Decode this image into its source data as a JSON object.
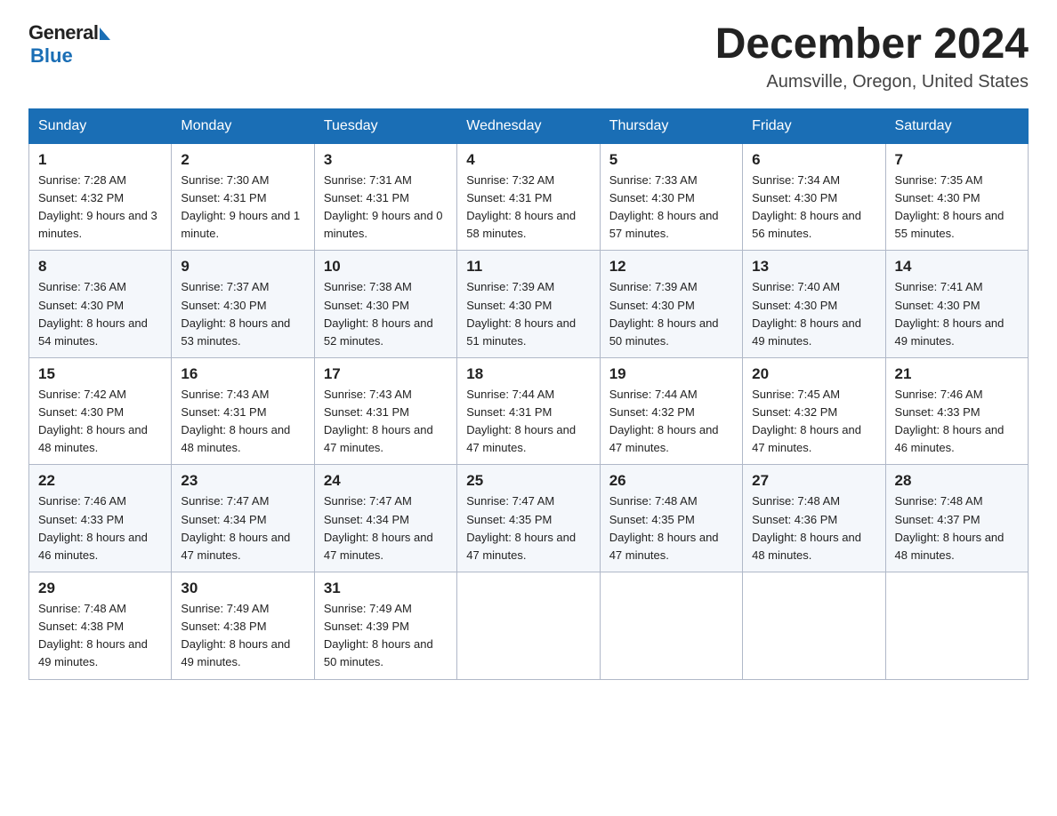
{
  "logo": {
    "general": "General",
    "blue": "Blue"
  },
  "title": "December 2024",
  "location": "Aumsville, Oregon, United States",
  "days_of_week": [
    "Sunday",
    "Monday",
    "Tuesday",
    "Wednesday",
    "Thursday",
    "Friday",
    "Saturday"
  ],
  "weeks": [
    [
      {
        "day": "1",
        "sunrise": "7:28 AM",
        "sunset": "4:32 PM",
        "daylight": "9 hours and 3 minutes."
      },
      {
        "day": "2",
        "sunrise": "7:30 AM",
        "sunset": "4:31 PM",
        "daylight": "9 hours and 1 minute."
      },
      {
        "day": "3",
        "sunrise": "7:31 AM",
        "sunset": "4:31 PM",
        "daylight": "9 hours and 0 minutes."
      },
      {
        "day": "4",
        "sunrise": "7:32 AM",
        "sunset": "4:31 PM",
        "daylight": "8 hours and 58 minutes."
      },
      {
        "day": "5",
        "sunrise": "7:33 AM",
        "sunset": "4:30 PM",
        "daylight": "8 hours and 57 minutes."
      },
      {
        "day": "6",
        "sunrise": "7:34 AM",
        "sunset": "4:30 PM",
        "daylight": "8 hours and 56 minutes."
      },
      {
        "day": "7",
        "sunrise": "7:35 AM",
        "sunset": "4:30 PM",
        "daylight": "8 hours and 55 minutes."
      }
    ],
    [
      {
        "day": "8",
        "sunrise": "7:36 AM",
        "sunset": "4:30 PM",
        "daylight": "8 hours and 54 minutes."
      },
      {
        "day": "9",
        "sunrise": "7:37 AM",
        "sunset": "4:30 PM",
        "daylight": "8 hours and 53 minutes."
      },
      {
        "day": "10",
        "sunrise": "7:38 AM",
        "sunset": "4:30 PM",
        "daylight": "8 hours and 52 minutes."
      },
      {
        "day": "11",
        "sunrise": "7:39 AM",
        "sunset": "4:30 PM",
        "daylight": "8 hours and 51 minutes."
      },
      {
        "day": "12",
        "sunrise": "7:39 AM",
        "sunset": "4:30 PM",
        "daylight": "8 hours and 50 minutes."
      },
      {
        "day": "13",
        "sunrise": "7:40 AM",
        "sunset": "4:30 PM",
        "daylight": "8 hours and 49 minutes."
      },
      {
        "day": "14",
        "sunrise": "7:41 AM",
        "sunset": "4:30 PM",
        "daylight": "8 hours and 49 minutes."
      }
    ],
    [
      {
        "day": "15",
        "sunrise": "7:42 AM",
        "sunset": "4:30 PM",
        "daylight": "8 hours and 48 minutes."
      },
      {
        "day": "16",
        "sunrise": "7:43 AM",
        "sunset": "4:31 PM",
        "daylight": "8 hours and 48 minutes."
      },
      {
        "day": "17",
        "sunrise": "7:43 AM",
        "sunset": "4:31 PM",
        "daylight": "8 hours and 47 minutes."
      },
      {
        "day": "18",
        "sunrise": "7:44 AM",
        "sunset": "4:31 PM",
        "daylight": "8 hours and 47 minutes."
      },
      {
        "day": "19",
        "sunrise": "7:44 AM",
        "sunset": "4:32 PM",
        "daylight": "8 hours and 47 minutes."
      },
      {
        "day": "20",
        "sunrise": "7:45 AM",
        "sunset": "4:32 PM",
        "daylight": "8 hours and 47 minutes."
      },
      {
        "day": "21",
        "sunrise": "7:46 AM",
        "sunset": "4:33 PM",
        "daylight": "8 hours and 46 minutes."
      }
    ],
    [
      {
        "day": "22",
        "sunrise": "7:46 AM",
        "sunset": "4:33 PM",
        "daylight": "8 hours and 46 minutes."
      },
      {
        "day": "23",
        "sunrise": "7:47 AM",
        "sunset": "4:34 PM",
        "daylight": "8 hours and 47 minutes."
      },
      {
        "day": "24",
        "sunrise": "7:47 AM",
        "sunset": "4:34 PM",
        "daylight": "8 hours and 47 minutes."
      },
      {
        "day": "25",
        "sunrise": "7:47 AM",
        "sunset": "4:35 PM",
        "daylight": "8 hours and 47 minutes."
      },
      {
        "day": "26",
        "sunrise": "7:48 AM",
        "sunset": "4:35 PM",
        "daylight": "8 hours and 47 minutes."
      },
      {
        "day": "27",
        "sunrise": "7:48 AM",
        "sunset": "4:36 PM",
        "daylight": "8 hours and 48 minutes."
      },
      {
        "day": "28",
        "sunrise": "7:48 AM",
        "sunset": "4:37 PM",
        "daylight": "8 hours and 48 minutes."
      }
    ],
    [
      {
        "day": "29",
        "sunrise": "7:48 AM",
        "sunset": "4:38 PM",
        "daylight": "8 hours and 49 minutes."
      },
      {
        "day": "30",
        "sunrise": "7:49 AM",
        "sunset": "4:38 PM",
        "daylight": "8 hours and 49 minutes."
      },
      {
        "day": "31",
        "sunrise": "7:49 AM",
        "sunset": "4:39 PM",
        "daylight": "8 hours and 50 minutes."
      },
      null,
      null,
      null,
      null
    ]
  ],
  "labels": {
    "sunrise": "Sunrise:",
    "sunset": "Sunset:",
    "daylight": "Daylight:"
  }
}
